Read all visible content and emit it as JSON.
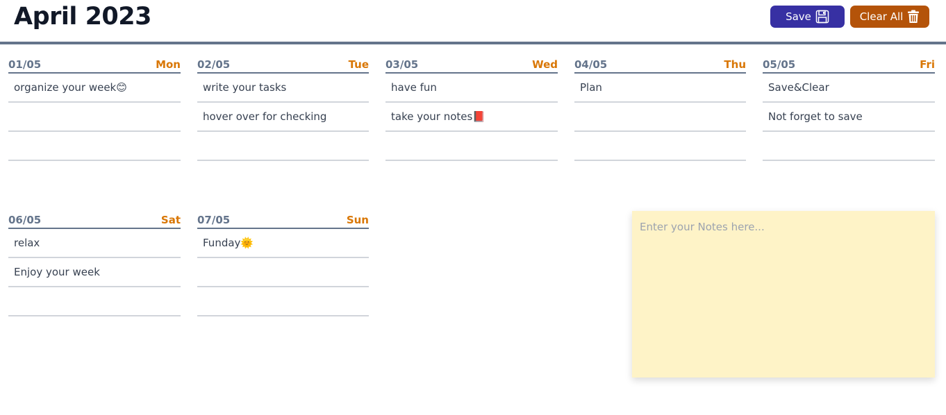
{
  "header": {
    "title": "April 2023",
    "save_label": "Save",
    "clear_label": "Clear All",
    "save_icon": "floppy-disk-icon",
    "clear_icon": "trash-icon"
  },
  "colors": {
    "save_button": "#3730a3",
    "clear_button": "#b45309",
    "day_name": "#d97706",
    "date": "#64748b",
    "notes_background": "#fef3c7"
  },
  "days": [
    {
      "date": "01/05",
      "name": "Mon",
      "tasks": [
        "organize your week😊",
        "",
        ""
      ]
    },
    {
      "date": "02/05",
      "name": "Tue",
      "tasks": [
        "write your tasks",
        "hover over for checking",
        ""
      ]
    },
    {
      "date": "03/05",
      "name": "Wed",
      "tasks": [
        "have fun",
        "take your notes📕",
        ""
      ]
    },
    {
      "date": "04/05",
      "name": "Thu",
      "tasks": [
        "Plan",
        "",
        ""
      ]
    },
    {
      "date": "05/05",
      "name": "Fri",
      "tasks": [
        "Save&Clear",
        "Not forget to save",
        ""
      ]
    },
    {
      "date": "06/05",
      "name": "Sat",
      "tasks": [
        "relax",
        "Enjoy your week",
        ""
      ]
    },
    {
      "date": "07/05",
      "name": "Sun",
      "tasks": [
        "Funday🌞",
        "",
        ""
      ]
    }
  ],
  "notes": {
    "placeholder": "Enter your Notes here...",
    "value": ""
  }
}
